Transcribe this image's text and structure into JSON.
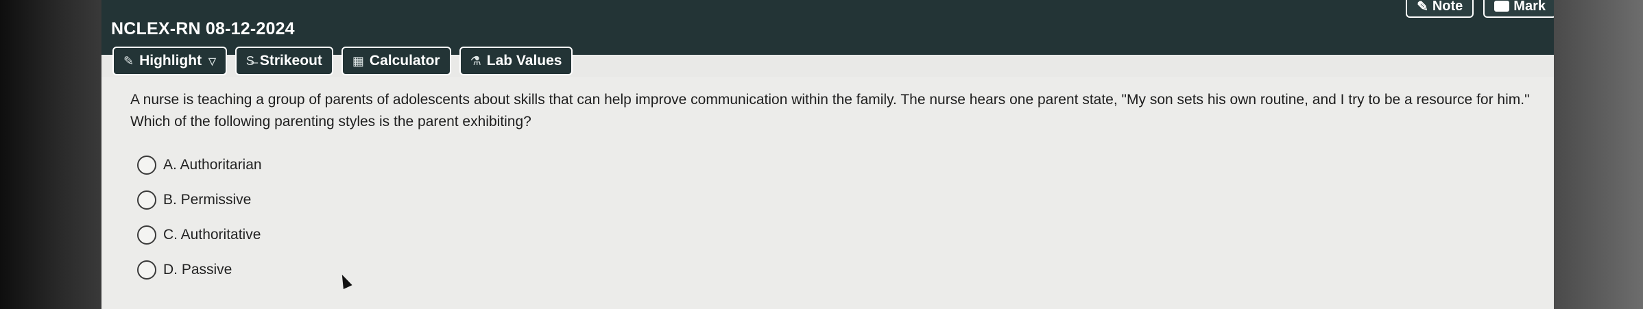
{
  "header": {
    "title": "NCLEX-RN 08-12-2024",
    "note_label": "Note",
    "mark_label": "Mark"
  },
  "toolbar": {
    "highlight_label": "Highlight",
    "strikeout_label": "Strikeout",
    "calculator_label": "Calculator",
    "lab_values_label": "Lab Values"
  },
  "question": {
    "stem": "A nurse is teaching a group of parents of adolescents about skills that can help improve communication within the family. The nurse hears one parent state, \"My son sets his own routine, and I try to be a resource for him.\" Which of the following parenting styles is the parent exhibiting?",
    "options": [
      "A. Authoritarian",
      "B. Permissive",
      "C. Authoritative",
      "D. Passive"
    ]
  }
}
